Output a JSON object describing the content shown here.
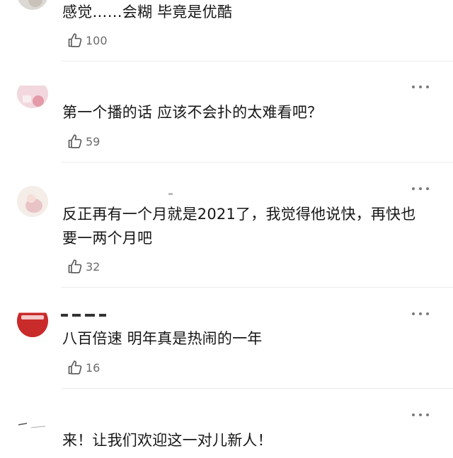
{
  "comments": [
    {
      "text": "感觉……会糊 毕竟是优酷",
      "likes": "100"
    },
    {
      "text": "第一个播的话 应该不会扑的太难看吧？",
      "likes": "59"
    },
    {
      "text": "反正再有一个月就是2021了，我觉得他说快，再快也要一两个月吧",
      "likes": "32"
    },
    {
      "text": "八百倍速 明年真是热闹的一年",
      "likes": "16"
    },
    {
      "text": "来！让我们欢迎这一对儿新人！",
      "likes": ""
    }
  ],
  "icons": {
    "like": "thumbs-up-icon",
    "more": "more-options-icon"
  },
  "colors": {
    "divider": "#ececec",
    "meta": "#6b6b6b",
    "avatar4": "#c92b2b"
  }
}
